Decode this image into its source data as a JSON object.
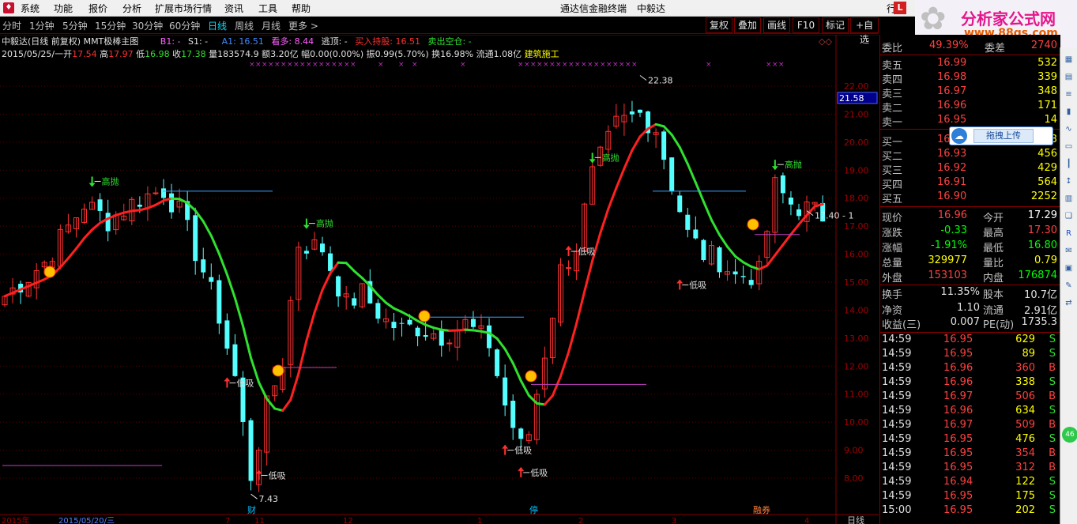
{
  "menubar": {
    "items": [
      "系统",
      "功能",
      "报价",
      "分析",
      "扩展市场行情",
      "资讯",
      "工具",
      "帮助"
    ],
    "app_title": "通达信金融终端",
    "stock_title": "中毅达",
    "right_cut": "行"
  },
  "brand": {
    "mark": "L",
    "logo_name": "分析家公式网",
    "logo_url": "www.88gs.com"
  },
  "period_tabs": [
    "分时",
    "1分钟",
    "5分钟",
    "15分钟",
    "30分钟",
    "60分钟",
    "日线",
    "周线",
    "月线",
    "更多 >"
  ],
  "active_tab": "日线",
  "toolbar": {
    "buttons": [
      "复权",
      "叠加",
      "画线",
      "F10",
      "标记",
      "+自选"
    ]
  },
  "indicator_line": {
    "title": "中毅达(日线 前复权) MMT极棒主图",
    "b1": "B1: -",
    "s1": "S1: -",
    "a1": "A1: 16.51",
    "kanduo": "看多: 8.44",
    "taoding": "逃顶: -",
    "buy_hold": "买入持股: 16.51",
    "sell_empty": "卖出空仓: -"
  },
  "ohlc_line": {
    "date": "2015/05/25/一",
    "open_label": "开",
    "open": "17.54",
    "high_label": "高",
    "high": "17.97",
    "low_label": "低",
    "low": "16.98",
    "close_label": "收",
    "close": "17.38",
    "vol": "量183574.9",
    "amount": "额3.20亿",
    "amp": "幅0.00(0.00%)",
    "swing": "振0.99(5.70%)",
    "turnover": "换16.98%",
    "float": "流通1.08亿",
    "industry": "建筑施工"
  },
  "chart_data": {
    "type": "candlestick",
    "ylim": [
      7.0,
      22.7
    ],
    "y_ticks": [
      "22.00",
      "21.00",
      "20.00",
      "19.00",
      "18.00",
      "17.00",
      "16.00",
      "15.00",
      "14.00",
      "13.00",
      "12.00",
      "11.00",
      "10.00",
      "9.00",
      "8.00"
    ],
    "current_price_tag": "21.58",
    "annotations": [
      {
        "text": "高抛",
        "idx": 11,
        "price": 18.6
      },
      {
        "text": "高抛",
        "idx": 38,
        "price": 17.1
      },
      {
        "text": "高抛",
        "idx": 74,
        "price": 19.45
      },
      {
        "text": "高抛",
        "idx": 97,
        "price": 19.2
      },
      {
        "text": "低吸",
        "idx": 28,
        "price": 11.4
      },
      {
        "text": "低吸",
        "idx": 32,
        "price": 8.1
      },
      {
        "text": "低吸",
        "idx": 63,
        "price": 9.0
      },
      {
        "text": "低吸",
        "idx": 65,
        "price": 8.2
      },
      {
        "text": "低吸",
        "idx": 85,
        "price": 14.9
      },
      {
        "text": "低吸",
        "idx": 71,
        "price": 16.1
      }
    ],
    "price_labels": [
      {
        "text": "22.38",
        "idx": 80,
        "price": 22.38
      },
      {
        "text": "7.43",
        "idx": 31,
        "price": 7.43
      },
      {
        "text": "17.40 - 1",
        "idx": 101,
        "price": 17.55
      }
    ],
    "bottom_markers": [
      "财",
      "停",
      "融券"
    ],
    "date_labels": [
      "2015年",
      "2015/05/20/三",
      "7",
      "11",
      "12",
      "1",
      "2",
      "3",
      "4"
    ],
    "bottom_right_label": "日线"
  },
  "quote": {
    "weibi_label": "委比",
    "weibi": "49.39%",
    "weicha_label": "委差",
    "weicha": "2740",
    "asks": [
      {
        "label": "卖五",
        "price": "16.99",
        "vol": "532"
      },
      {
        "label": "卖四",
        "price": "16.98",
        "vol": "339"
      },
      {
        "label": "卖三",
        "price": "16.97",
        "vol": "348"
      },
      {
        "label": "卖二",
        "price": "16.96",
        "vol": "171"
      },
      {
        "label": "卖一",
        "price": "16.95",
        "vol": "14"
      }
    ],
    "bids": [
      {
        "label": "买一",
        "price": "16.94",
        "vol": "443"
      },
      {
        "label": "买二",
        "price": "16.93",
        "vol": "456"
      },
      {
        "label": "买三",
        "price": "16.92",
        "vol": "429"
      },
      {
        "label": "买四",
        "price": "16.91",
        "vol": "564"
      },
      {
        "label": "买五",
        "price": "16.90",
        "vol": "2252"
      }
    ],
    "stats": [
      {
        "l": "现价",
        "v": "16.96",
        "vc": "#ff4040",
        "l2": "今开",
        "v2": "17.29",
        "v2c": "#ffffff"
      },
      {
        "l": "涨跌",
        "v": "-0.33",
        "vc": "#00ff00",
        "l2": "最高",
        "v2": "17.30",
        "v2c": "#ff4040"
      },
      {
        "l": "涨幅",
        "v": "-1.91%",
        "vc": "#00ff00",
        "l2": "最低",
        "v2": "16.80",
        "v2c": "#00ff00"
      },
      {
        "l": "总量",
        "v": "329977",
        "vc": "#ffff00",
        "l2": "量比",
        "v2": "0.79",
        "v2c": "#ffff00"
      },
      {
        "l": "外盘",
        "v": "153103",
        "vc": "#ff4040",
        "l2": "内盘",
        "v2": "176874",
        "v2c": "#00ff00"
      }
    ],
    "fin": [
      {
        "l": "换手",
        "v": "11.35%",
        "l2": "股本",
        "v2": "10.7亿"
      },
      {
        "l": "净资",
        "v": "1.10",
        "l2": "流通",
        "v2": "2.91亿"
      },
      {
        "l": "收益(三)",
        "v": "0.007",
        "l2": "PE(动)",
        "v2": "1735.3"
      }
    ],
    "ticks": [
      {
        "t": "14:59",
        "p": "16.95",
        "v": "629",
        "bs": "S"
      },
      {
        "t": "14:59",
        "p": "16.95",
        "v": "89",
        "bs": "S"
      },
      {
        "t": "14:59",
        "p": "16.96",
        "v": "360",
        "bs": "B"
      },
      {
        "t": "14:59",
        "p": "16.96",
        "v": "338",
        "bs": "S"
      },
      {
        "t": "14:59",
        "p": "16.97",
        "v": "506",
        "bs": "B"
      },
      {
        "t": "14:59",
        "p": "16.96",
        "v": "634",
        "bs": "S"
      },
      {
        "t": "14:59",
        "p": "16.97",
        "v": "509",
        "bs": "B"
      },
      {
        "t": "14:59",
        "p": "16.95",
        "v": "476",
        "bs": "S"
      },
      {
        "t": "14:59",
        "p": "16.95",
        "v": "354",
        "bs": "B"
      },
      {
        "t": "14:59",
        "p": "16.95",
        "v": "312",
        "bs": "B"
      },
      {
        "t": "14:59",
        "p": "16.94",
        "v": "122",
        "bs": "S"
      },
      {
        "t": "14:59",
        "p": "16.95",
        "v": "175",
        "bs": "S"
      },
      {
        "t": "15:00",
        "p": "16.95",
        "v": "202",
        "bs": "S"
      }
    ]
  },
  "upload_widget": {
    "label": "拖拽上传"
  },
  "colors": {
    "up": "#ff3030",
    "down": "#54ffff",
    "ma_up": "#ff2020",
    "ma_down": "#30e030",
    "grid": "#600000"
  }
}
